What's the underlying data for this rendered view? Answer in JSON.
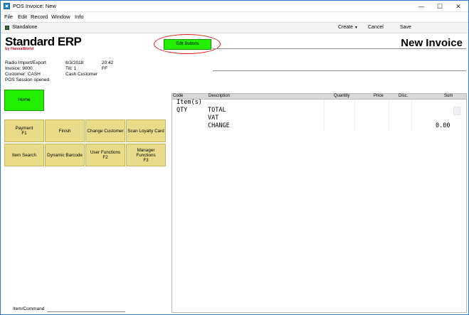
{
  "window": {
    "title": "POS Invoice: New"
  },
  "menu": [
    "File",
    "Edit",
    "Record",
    "Window",
    "Info"
  ],
  "toolbar": {
    "mode_label": "Standalone",
    "create_label": "Create",
    "cancel_label": "Cancel",
    "save_label": "Save"
  },
  "brand": {
    "main": "Standard ERP",
    "sub": "by HansaWorld"
  },
  "edit_buttons_label": "Edit Buttons",
  "page_title": "New Invoice",
  "info": {
    "company": "Radio Import/Export",
    "date": "6/3/2018",
    "time": "20:42",
    "invoice": "Invoice: 9000",
    "till": "Till: 1",
    "ff": "FF",
    "customer": "Customer: CASH",
    "customer_name": "Cash Customer",
    "session": "POS Session opened"
  },
  "home_label": "Home",
  "function_keys": [
    "Payment\nF1",
    "Finish",
    "Change Customer",
    "Scan Loyalty Card",
    "Item Search",
    "Dynamic Barcode",
    "User Functions\nF2",
    "Manager\nFunctions\nF3"
  ],
  "grid": {
    "columns": [
      "Code",
      "Description",
      "Quantity",
      "Price",
      "Disc.",
      "Sum"
    ],
    "items_label": "Item(s)",
    "qty_label": "QTY",
    "total_label": "TOTAL",
    "vat_label": "VAT",
    "change_label": "CHANGE",
    "change_value": "0.00"
  },
  "command": {
    "label": "Item/Command"
  }
}
